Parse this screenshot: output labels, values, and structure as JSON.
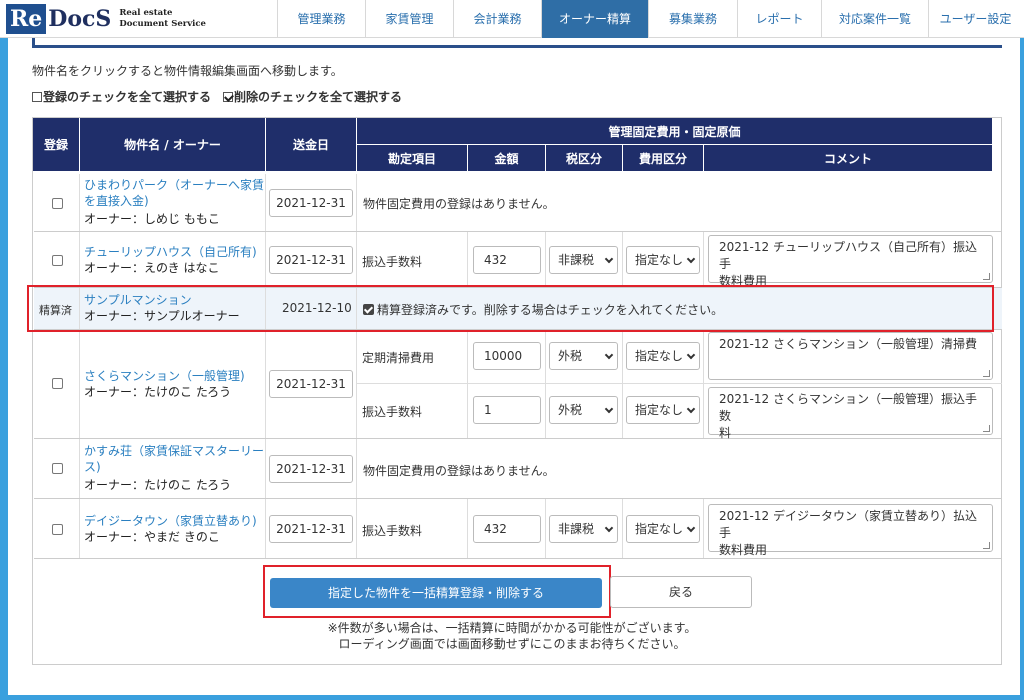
{
  "logo": {
    "re": "Re",
    "docs": "DocS",
    "sub1": "Real estate",
    "sub2": "Document Service"
  },
  "nav": [
    "管理業務",
    "家賃管理",
    "会計業務",
    "オーナー精算",
    "募集業務",
    "レポート",
    "対応案件一覧",
    "ユーザー設定"
  ],
  "nav_active": "オーナー精算",
  "info_text": "物件名をクリックすると物件情報編集画面へ移動します。",
  "check_all": {
    "register": "登録のチェックを全て選択する",
    "delete": "削除のチェックを全て選択する"
  },
  "table": {
    "headers": {
      "register": "登録",
      "property": "物件名 / オーナー",
      "send_date": "送金日",
      "fixed_group": "管理固定費用・固定原価",
      "item": "勘定項目",
      "amount": "金額",
      "tax": "税区分",
      "cost": "費用区分",
      "comment": "コメント"
    },
    "rows": [
      {
        "name": "ひまわりパーク（オーナーへ家賃を直接入金)",
        "name_l1": "ひまわりパーク（オーナーへ家賃",
        "name_l2": "を直接入金)",
        "owner": "オーナー：しめじ ももこ",
        "date": "2021-12-31",
        "message": "物件固定費用の登録はありません。"
      },
      {
        "name": "チューリップハウス（自己所有)",
        "owner": "オーナー：えのき はなこ",
        "date": "2021-12-31",
        "item": "振込手数料",
        "amount": "432",
        "tax": "非課税",
        "cost": "指定なし",
        "comment_l1": "2021-12 チューリップハウス（自己所有）振込手",
        "comment_l2": "数料費用"
      },
      {
        "status": "精算済",
        "name": "サンプルマンション",
        "owner": "オーナー：サンプルオーナー",
        "date": "2021-12-10",
        "message": "精算登録済みです。削除する場合はチェックを入れてください。"
      },
      {
        "name": "さくらマンション（一般管理)",
        "owner": "オーナー：たけのこ たろう",
        "date": "2021-12-31",
        "sub": [
          {
            "item": "定期清掃費用",
            "amount": "10000",
            "tax": "外税",
            "cost": "指定なし",
            "comment_l1": "2021-12 さくらマンション（一般管理）清掃費",
            "comment_l2": ""
          },
          {
            "item": "振込手数料",
            "amount": "1",
            "tax": "外税",
            "cost": "指定なし",
            "comment_l1": "2021-12 さくらマンション（一般管理）振込手数",
            "comment_l2": "料"
          }
        ]
      },
      {
        "name_l1": "かすみ荘（家賃保証マスターリー",
        "name_l2": "ス)",
        "owner": "オーナー：たけのこ たろう",
        "date": "2021-12-31",
        "message": "物件固定費用の登録はありません。"
      },
      {
        "name": "デイジータウン（家賃立替あり)",
        "owner": "オーナー：やまだ きのこ",
        "date": "2021-12-31",
        "item": "振込手数料",
        "amount": "432",
        "tax": "非課税",
        "cost": "指定なし",
        "comment_l1": "2021-12 デイジータウン（家賃立替あり）払込手",
        "comment_l2": "数料費用"
      }
    ]
  },
  "buttons": {
    "submit": "指定した物件を一括精算登録・削除する",
    "back": "戻る"
  },
  "notes": {
    "line1": "※件数が多い場合は、一括精算に時間がかかる可能性がございます。",
    "line2": "ローディング画面では画面移動せずにこのままお待ちください。"
  },
  "colors": {
    "header_navy": "#1f2e6a",
    "accent_blue": "#3a86c8",
    "highlight_red": "#e0212a",
    "background": "#3aa0de"
  }
}
